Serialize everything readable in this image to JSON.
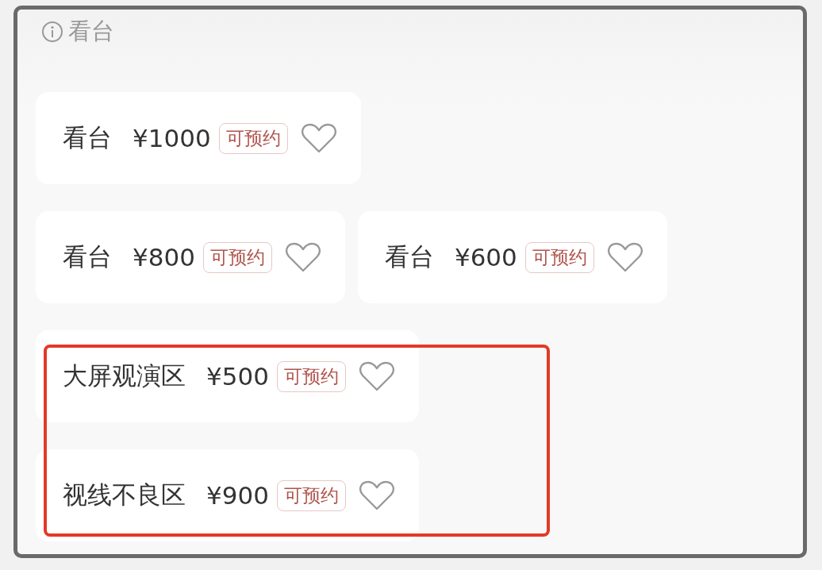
{
  "section": {
    "title": "看台"
  },
  "rows": [
    {
      "highlighted": false,
      "cards": [
        {
          "name": "看台",
          "price": "¥1000",
          "badge": "可预约",
          "favorited": false
        }
      ]
    },
    {
      "highlighted": false,
      "cards": [
        {
          "name": "看台",
          "price": "¥800",
          "badge": "可预约",
          "favorited": false
        },
        {
          "name": "看台",
          "price": "¥600",
          "badge": "可预约",
          "favorited": false
        }
      ]
    },
    {
      "highlighted": true,
      "cards": [
        {
          "name": "大屏观演区",
          "price": "¥500",
          "badge": "可预约",
          "favorited": false
        }
      ]
    },
    {
      "highlighted": true,
      "cards": [
        {
          "name": "视线不良区",
          "price": "¥900",
          "badge": "可预约",
          "favorited": false
        }
      ]
    }
  ]
}
